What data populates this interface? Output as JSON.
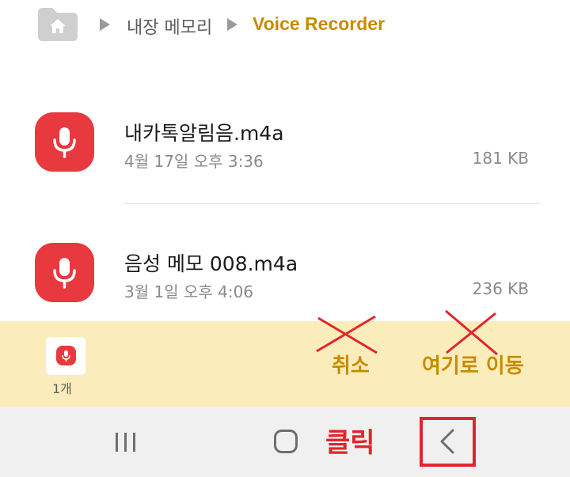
{
  "breadcrumb": {
    "internal_storage": "내장 메모리",
    "current_folder": "Voice Recorder"
  },
  "files": [
    {
      "name": "내카톡알림음.m4a",
      "date": "4월 17일 오후 3:36",
      "size": "181 KB",
      "icon": "mic-icon"
    },
    {
      "name": "음성 메모 008.m4a",
      "date": "3월 1일 오후 4:06",
      "size": "236 KB",
      "icon": "mic-icon"
    }
  ],
  "move_bar": {
    "count": "1개",
    "cancel_label": "취소",
    "move_here_label": "여기로 이동"
  },
  "nav": {
    "annotation": "클릭"
  },
  "colors": {
    "accent": "#c78b00",
    "icon_red": "#e8393f",
    "annotation_red": "#e3242b",
    "move_bar_bg": "#fbecbb"
  }
}
